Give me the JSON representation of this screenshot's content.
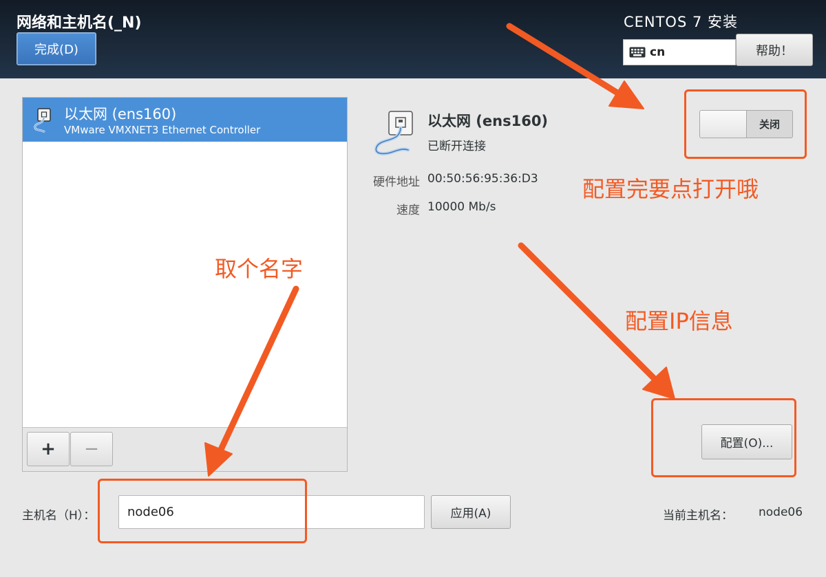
{
  "header": {
    "title": "网络和主机名(_N)",
    "done_label": "完成(D)",
    "install_title": "CENTOS 7 安装",
    "keyboard_layout": "cn",
    "help_label": "帮助！"
  },
  "device_list": {
    "items": [
      {
        "name": "以太网 (ens160)",
        "description": "VMware VMXNET3 Ethernet Controller",
        "selected": true
      }
    ],
    "add_label": "+",
    "remove_label": "−"
  },
  "device_detail": {
    "name": "以太网 (ens160)",
    "status": "已断开连接",
    "hw_label": "硬件地址",
    "hw_value": "00:50:56:95:36:D3",
    "speed_label": "速度",
    "speed_value": "10000 Mb/s",
    "toggle_label": "关闭",
    "toggle_on": false,
    "config_label": "配置(O)..."
  },
  "hostname": {
    "label": "主机名（H）：",
    "value": "node06",
    "apply_label": "应用(A)",
    "current_label": "当前主机名：",
    "current_value": "node06"
  },
  "annotations": {
    "toggle_note": "配置完要点打开哦",
    "name_note": "取个名字",
    "ip_note": "配置IP信息",
    "color": "#f25a23"
  },
  "colors": {
    "header_bg": "#1c2a3a",
    "selection": "#4a90d9",
    "done_button": "#3a74bd"
  }
}
